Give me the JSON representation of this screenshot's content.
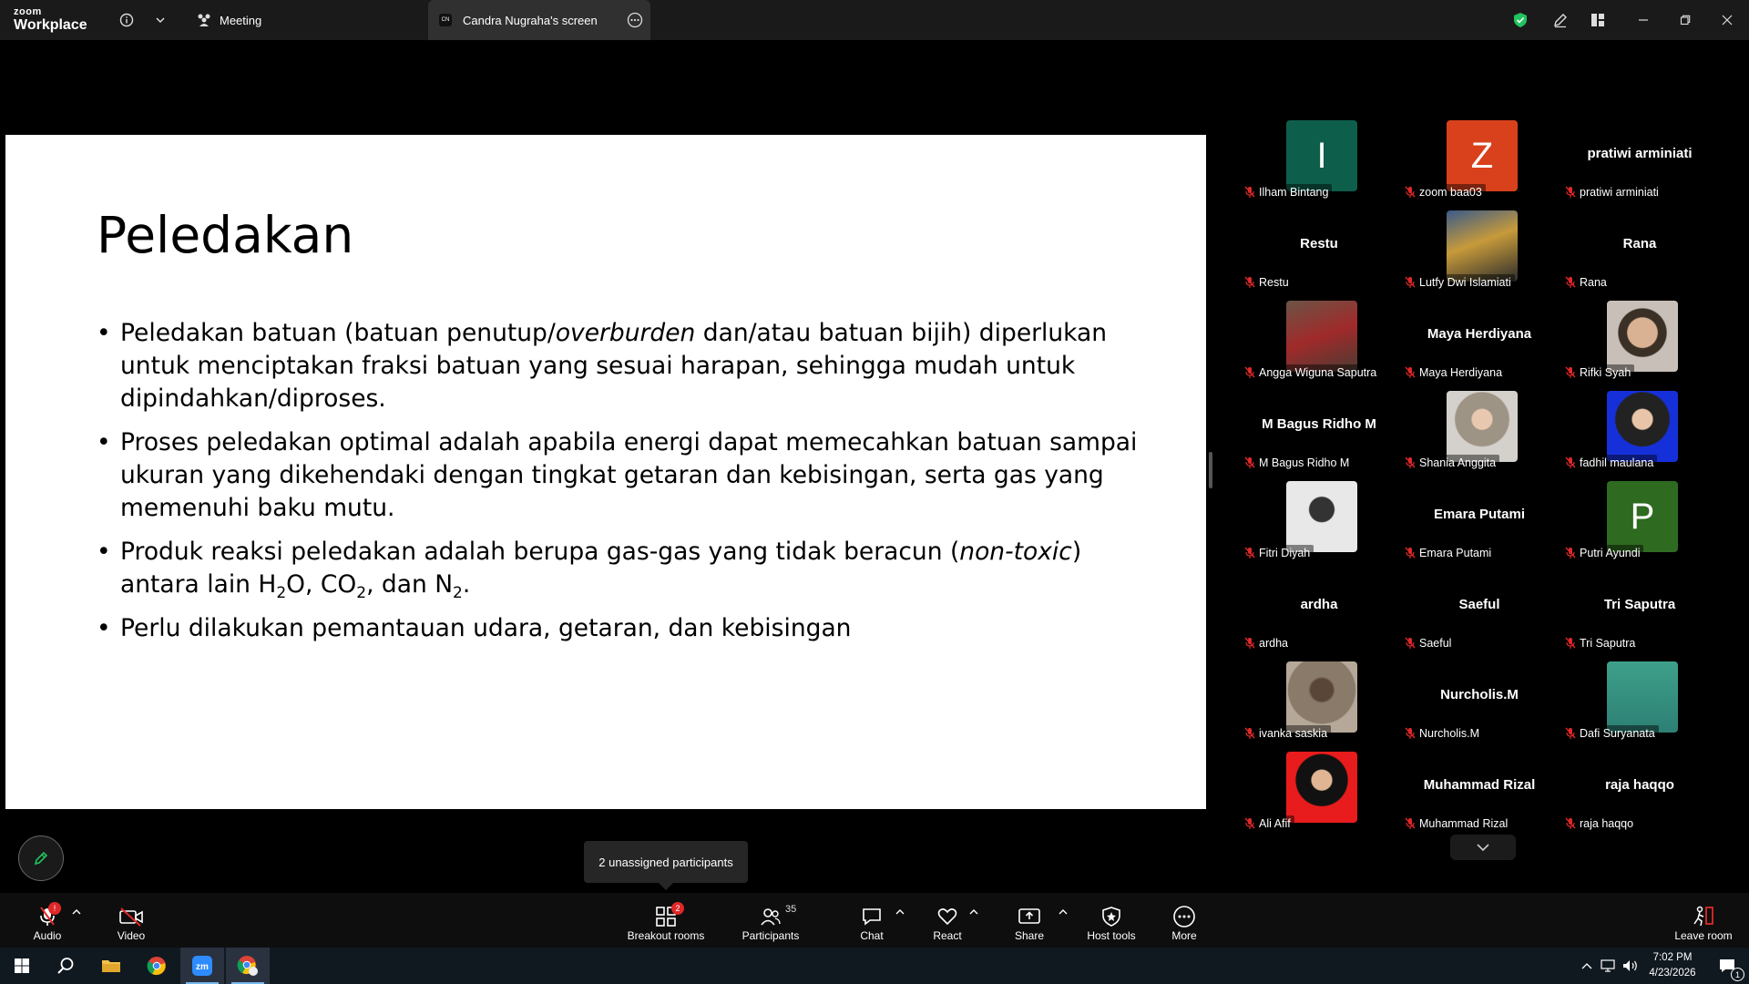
{
  "app": {
    "logo_top": "zoom",
    "logo_bottom": "Workplace"
  },
  "tabs": {
    "meeting": "Meeting",
    "screen_share": "Candra Nugraha's screen",
    "screen_share_avatar": "CN"
  },
  "slide": {
    "title": "Peledakan",
    "bullets": {
      "b1_pre": "Peledakan batuan (batuan penutup/",
      "b1_italic": "overburden",
      "b1_post": " dan/atau batuan bijih) diperlukan untuk menciptakan fraksi batuan yang sesuai harapan, sehingga mudah untuk dipindahkan/diproses.",
      "b2": "Proses peledakan optimal adalah apabila energi dapat memecahkan batuan sampai ukuran yang dikehendaki dengan tingkat getaran dan kebisingan, serta gas yang memenuhi baku mutu.",
      "b3_pre": "Produk reaksi peledakan adalah berupa gas-gas yang tidak beracun (",
      "b3_italic": "non-toxic",
      "b3_mid": ") antara lain H",
      "sub_2": "2",
      "b3_o": "O, CO",
      "b3_n": ", dan N",
      "b3_end": ".",
      "b4": "Perlu dilakukan pemantauan udara, getaran, dan kebisingan"
    }
  },
  "participants": [
    {
      "label": "Ilham Bintang",
      "avatar_letter": "I",
      "avatar_color": "#0e5e4c",
      "big_name": ""
    },
    {
      "label": "zoom baa03",
      "avatar_letter": "Z",
      "avatar_color": "#d9411c",
      "big_name": ""
    },
    {
      "label": "pratiwi arminiati",
      "avatar_letter": "",
      "avatar_color": "",
      "big_name": "pratiwi arminiati"
    },
    {
      "label": "Restu",
      "avatar_letter": "",
      "avatar_color": "",
      "big_name": "Restu"
    },
    {
      "label": "Lutfy Dwi Islamiati",
      "avatar_letter": "",
      "avatar_color": "",
      "big_name": "",
      "photo": "linear-gradient(160deg,#3a5a8a,#c79a3a 45%,#2c2c2c)"
    },
    {
      "label": "Rana",
      "avatar_letter": "",
      "avatar_color": "",
      "big_name": "Rana"
    },
    {
      "label": "Angga Wiguna Saputra",
      "avatar_letter": "",
      "avatar_color": "",
      "big_name": "",
      "photo": "linear-gradient(160deg,#6b5446,#a02a2a 50%,#4b3b33)"
    },
    {
      "label": "Maya Herdiyana",
      "avatar_letter": "",
      "avatar_color": "",
      "big_name": "Maya Herdiyana"
    },
    {
      "label": "Rifki Syah",
      "avatar_letter": "",
      "avatar_color": "",
      "big_name": "",
      "photo": "radial-gradient(circle at 50% 45%,#d9b293 0 28%,#3b3026 30% 45%,#c8c0b8 47%)"
    },
    {
      "label": "M Bagus Ridho M",
      "avatar_letter": "",
      "avatar_color": "",
      "big_name": "M Bagus Ridho M"
    },
    {
      "label": "Shania Anggita",
      "avatar_letter": "",
      "avatar_color": "",
      "big_name": "",
      "photo": "radial-gradient(circle at 50% 40%,#e8c9b0 0 18%,#9e9486 20% 48%,#d4d0cb 50%)"
    },
    {
      "label": "fadhil maulana",
      "avatar_letter": "",
      "avatar_color": "",
      "big_name": "",
      "photo": "radial-gradient(circle at 50% 40%,#e8c5a8 0 18%,#222 20% 48%,#1530d8 50%)"
    },
    {
      "label": "Fitri Diyah",
      "avatar_letter": "",
      "avatar_color": "",
      "big_name": "",
      "photo": "radial-gradient(circle at 50% 40%,#333 0 22%,#e8e8e8 24%)"
    },
    {
      "label": "Emara Putami",
      "avatar_letter": "",
      "avatar_color": "",
      "big_name": "Emara Putami"
    },
    {
      "label": "Putri Ayundi",
      "avatar_letter": "P",
      "avatar_color": "#2e6a1f",
      "big_name": ""
    },
    {
      "label": "ardha",
      "avatar_letter": "",
      "avatar_color": "",
      "big_name": "ardha"
    },
    {
      "label": "Saeful",
      "avatar_letter": "",
      "avatar_color": "",
      "big_name": "Saeful"
    },
    {
      "label": "Tri Saputra",
      "avatar_letter": "",
      "avatar_color": "",
      "big_name": "Tri Saputra"
    },
    {
      "label": "ivanka saskia",
      "avatar_letter": "",
      "avatar_color": "",
      "big_name": "",
      "photo": "radial-gradient(circle at 50% 40%,#5a4638 0 20%,#8a7a6a 24% 60%,#b6a898 62%)"
    },
    {
      "label": "Nurcholis.M",
      "avatar_letter": "",
      "avatar_color": "",
      "big_name": "Nurcholis.M"
    },
    {
      "label": "Dafi Suryanata",
      "avatar_letter": "",
      "avatar_color": "",
      "big_name": "",
      "photo": "linear-gradient(180deg,#3ea08a,#2d7f74)"
    },
    {
      "label": "Ali Afif",
      "avatar_letter": "",
      "avatar_color": "",
      "big_name": "",
      "photo": "radial-gradient(circle at 50% 40%,#e0b593 0 18%,#111 20% 46%,#e81c1c 48%)"
    },
    {
      "label": "Muhammad Rizal",
      "avatar_letter": "",
      "avatar_color": "",
      "big_name": "Muhammad Rizal"
    },
    {
      "label": "raja haqqo",
      "avatar_letter": "",
      "avatar_color": "",
      "big_name": "raja haqqo"
    }
  ],
  "tooltip": "2 unassigned participants",
  "toolbar": {
    "audio": "Audio",
    "video": "Video",
    "breakout": "Breakout rooms",
    "breakout_badge": "2",
    "participants": "Participants",
    "participants_count": "35",
    "chat": "Chat",
    "react": "React",
    "share": "Share",
    "host_tools": "Host tools",
    "more": "More",
    "leave": "Leave room"
  },
  "taskbar": {
    "time": "7:02 PM",
    "date": "4/23/2026",
    "notification_count": "1"
  },
  "colors": {
    "mute_red": "#e02828",
    "shield_green": "#21c35e"
  }
}
